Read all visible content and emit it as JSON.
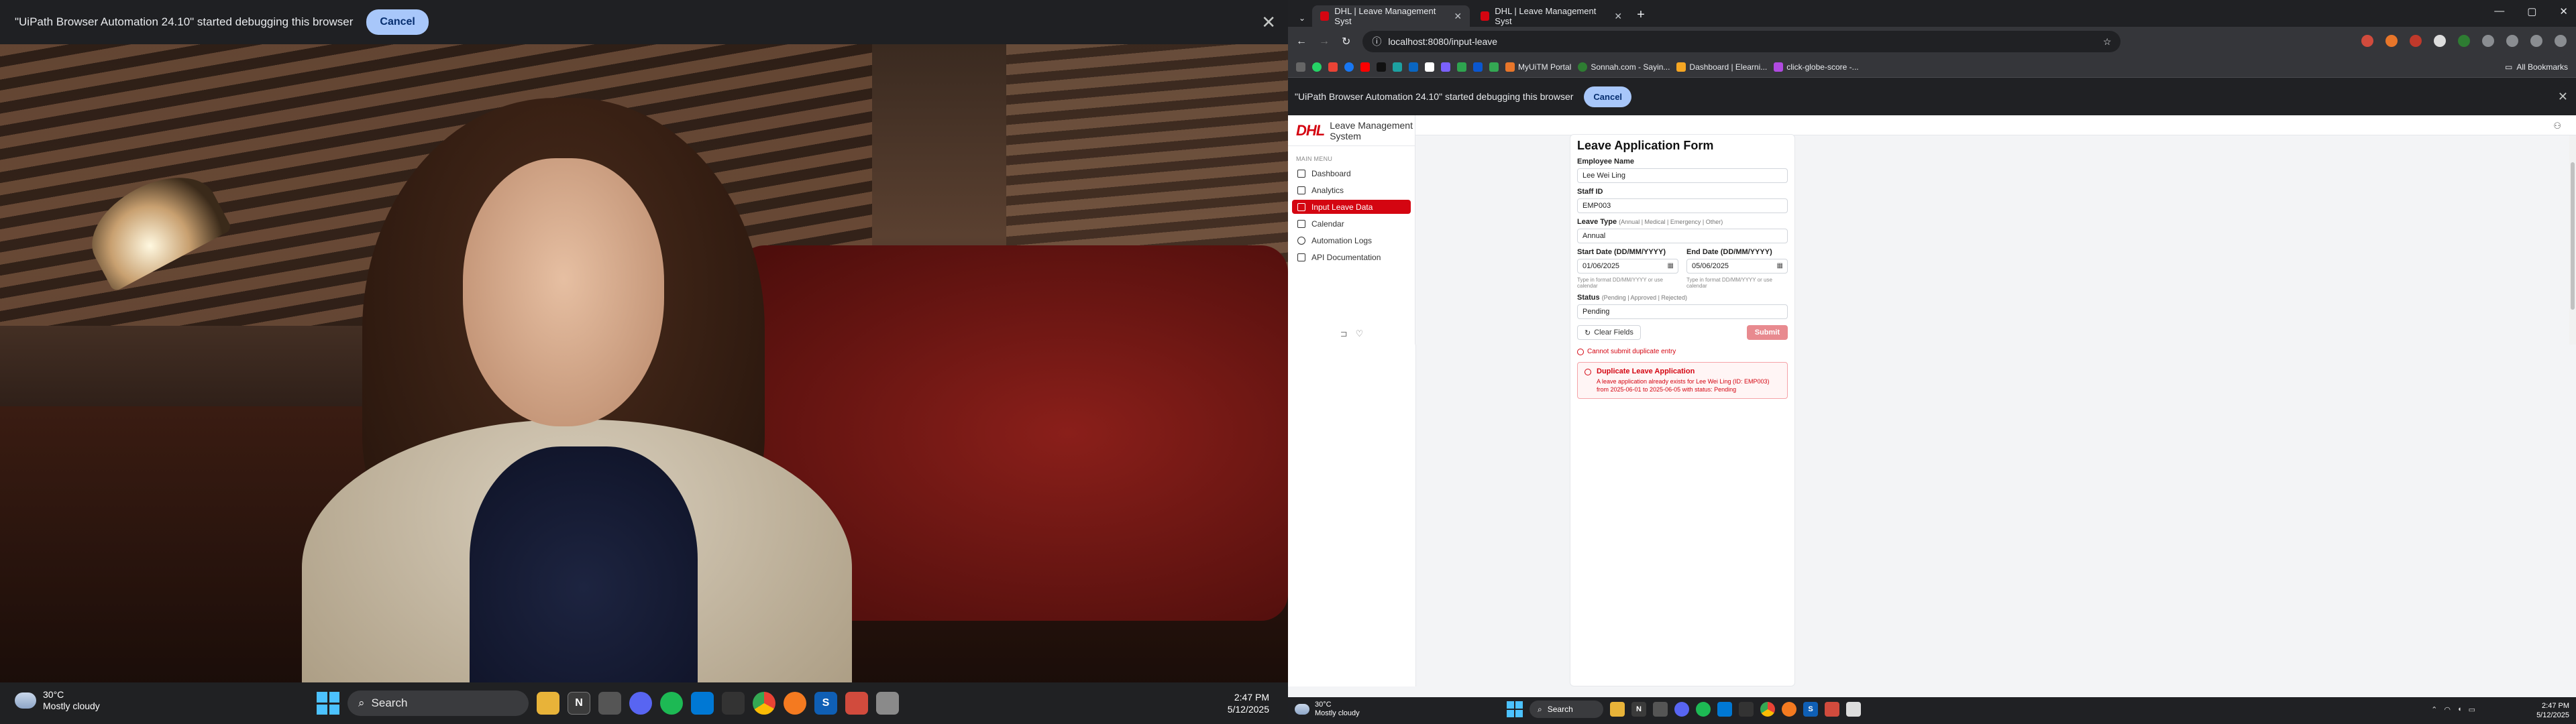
{
  "left": {
    "debug_bar": {
      "message": "\"UiPath Browser Automation 24.10\" started debugging this browser",
      "cancel": "Cancel",
      "close": "✕"
    },
    "taskbar": {
      "weather": {
        "temp": "30°C",
        "desc": "Mostly cloudy"
      },
      "search": "Search",
      "time": "2:47 PM",
      "date": "5/12/2025"
    }
  },
  "browser": {
    "tabs": [
      {
        "title": "DHL | Leave Management Syst"
      },
      {
        "title": "DHL | Leave Management Syst"
      }
    ],
    "url": "localhost:8080/input-leave",
    "bookmarks": [
      "MyUiTM Portal",
      "Sonnah.com - Sayin...",
      "Dashboard | Elearni...",
      "click-globe-score -..."
    ],
    "all_bookmarks": "All Bookmarks",
    "infobar": {
      "message": "\"UiPath Browser Automation 24.10\" started debugging this browser",
      "cancel": "Cancel"
    }
  },
  "app": {
    "logo": "DHL",
    "title": "Leave Management System",
    "menu_label": "MAIN MENU",
    "nav": [
      "Dashboard",
      "Analytics",
      "Input Leave Data",
      "Calendar",
      "Automation Logs",
      "API Documentation"
    ],
    "form": {
      "title": "Leave Application Form",
      "employee_label": "Employee Name",
      "employee_value": "Lee Wei Ling",
      "staff_label": "Staff ID",
      "staff_value": "EMP003",
      "leave_label": "Leave Type",
      "leave_hint": "(Annual | Medical | Emergency | Other)",
      "leave_value": "Annual",
      "start_label": "Start Date (DD/MM/YYYY)",
      "start_value": "01/06/2025",
      "start_hint": "Type in format DD/MM/YYYY or use calendar",
      "end_label": "End Date (DD/MM/YYYY)",
      "end_value": "05/06/2025",
      "end_hint": "Type in format DD/MM/YYYY or use calendar",
      "status_label": "Status",
      "status_hint": "(Pending | Approved | Rejected)",
      "status_value": "Pending",
      "clear": "Clear Fields",
      "submit": "Submit",
      "dup_inline": "Cannot submit duplicate entry",
      "alert_title": "Duplicate Leave Application",
      "alert_desc": "A leave application already exists for Lee Wei Ling (ID: EMP003) from 2025-06-01 to 2025-06-05 with status: Pending"
    }
  },
  "right_taskbar": {
    "weather": {
      "temp": "30°C",
      "desc": "Mostly cloudy"
    },
    "search": "Search",
    "time": "2:47 PM",
    "date": "5/12/2025"
  },
  "colors": {
    "dhl_red": "#d40511",
    "active_nav": "#d40511",
    "submit_disabled": "#e88a8f"
  }
}
